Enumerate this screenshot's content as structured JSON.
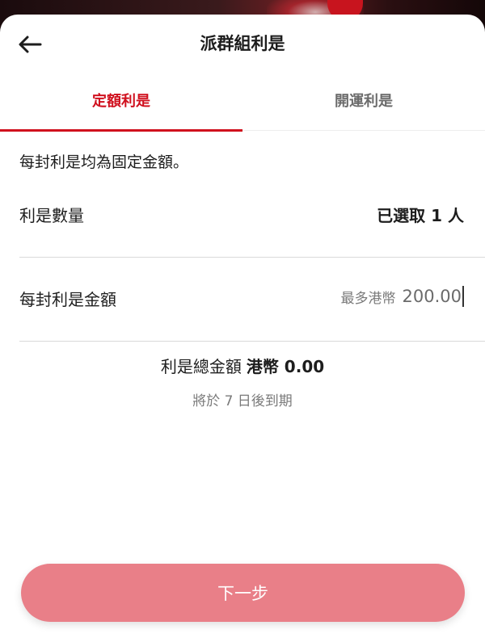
{
  "header": {
    "title": "派群組利是",
    "back_icon": "arrow-left-icon"
  },
  "tabs": [
    {
      "label": "定額利是",
      "active": true
    },
    {
      "label": "開運利是",
      "active": false
    }
  ],
  "description": "每封利是均為固定金額。",
  "quantity": {
    "label": "利是數量",
    "value": "已選取 1 人"
  },
  "amount": {
    "label": "每封利是金額",
    "prefix": "最多港幣",
    "value": "200.00"
  },
  "total": {
    "label": "利是總金額",
    "amount": "港幣 0.00"
  },
  "expiry": "將於 7 日後到期",
  "next_button": {
    "label": "下一步"
  },
  "colors": {
    "accent": "#d0101e",
    "button": "#e97f88"
  }
}
